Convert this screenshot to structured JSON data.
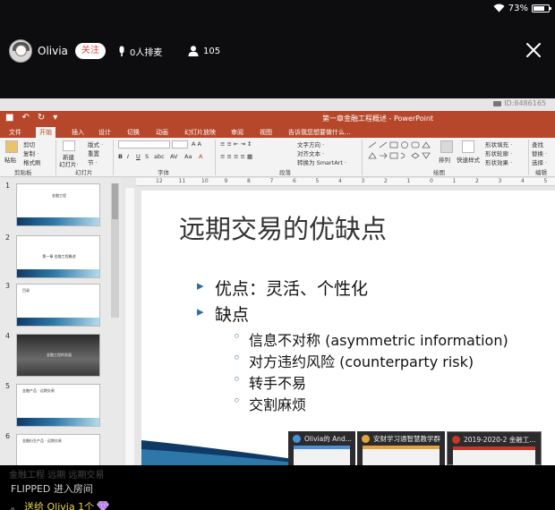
{
  "status": {
    "battery_text": "73%",
    "battery_level": 0.73
  },
  "stream": {
    "host_name": "Olivia",
    "follow_label": "关注",
    "rank_text": "0人排麦",
    "viewer_count": "105"
  },
  "ppt": {
    "watermark": "ID:8486165",
    "window_title": "第一章金融工程概述 - PowerPoint",
    "tabs": [
      "文件",
      "开始",
      "插入",
      "设计",
      "切换",
      "动画",
      "幻灯片放映",
      "审阅",
      "视图",
      "告诉我您想要做什么..."
    ],
    "active_tab": "开始",
    "ribbon": {
      "paste": "粘贴",
      "cut": "剪切",
      "copy": "复制 ·",
      "format_painter": "格式刷",
      "new_slide": "新建",
      "new_slide_2": "幻灯片·",
      "layout": "版式 ·",
      "reset": "重置",
      "section": "节 ·",
      "text_direction": "文字方向 ·",
      "align_text": "对齐文本 ·",
      "smartart": "转换为 SmartArt ·",
      "arrange": "排列",
      "quick_styles": "快速样式",
      "shape_fill": "形状填充 ·",
      "shape_outline": "形状轮廓 ·",
      "shape_effect": "形状效果 ·",
      "find": "查找",
      "replace": "替换 ·",
      "select": "选择 ·",
      "groups": {
        "clipboard": "剪贴板",
        "slides": "幻灯片",
        "font": "字体",
        "paragraph": "段落",
        "drawing": "绘图",
        "editing": "编辑"
      }
    },
    "ruler_labels": [
      "12",
      "11",
      "10",
      "9",
      "8",
      "7",
      "6",
      "5",
      "4",
      "3",
      "2",
      "1",
      "0",
      "1",
      "2",
      "3",
      "4",
      "5"
    ],
    "thumbnails": [
      {
        "num": "1",
        "title": "金融工程"
      },
      {
        "num": "2",
        "title": "第一章 金融工程概述"
      },
      {
        "num": "3",
        "title": "目录"
      },
      {
        "num": "4",
        "title": "金融工程的发展"
      },
      {
        "num": "5",
        "title": "金融产品 · 远期交易"
      },
      {
        "num": "6",
        "title": "金融衍生产品 · 远期交易"
      }
    ],
    "slide": {
      "title": "远期交易的优缺点",
      "bullet1": "优点：灵活、个性化",
      "bullet2": "缺点",
      "sub1": "信息不对称 (asymmetric information)",
      "sub2": "对方违约风险 (counterparty risk)",
      "sub3": "转手不易",
      "sub4": "交割麻烦"
    },
    "taskbar_previews": [
      {
        "label": "Olivia的 And...",
        "color": "#4a90d9"
      },
      {
        "label": "安财学习通智慧教学群",
        "color": "#e6a23c"
      },
      {
        "label": "2019-2020-2 金融工...",
        "color": "#c0392b"
      }
    ]
  },
  "chat": {
    "prev_text": "金融工程 远期 远期交易",
    "line1": "FLIPPED 进入房间",
    "line2_lead": "。",
    "line2": "送给 Olivia 1个"
  }
}
